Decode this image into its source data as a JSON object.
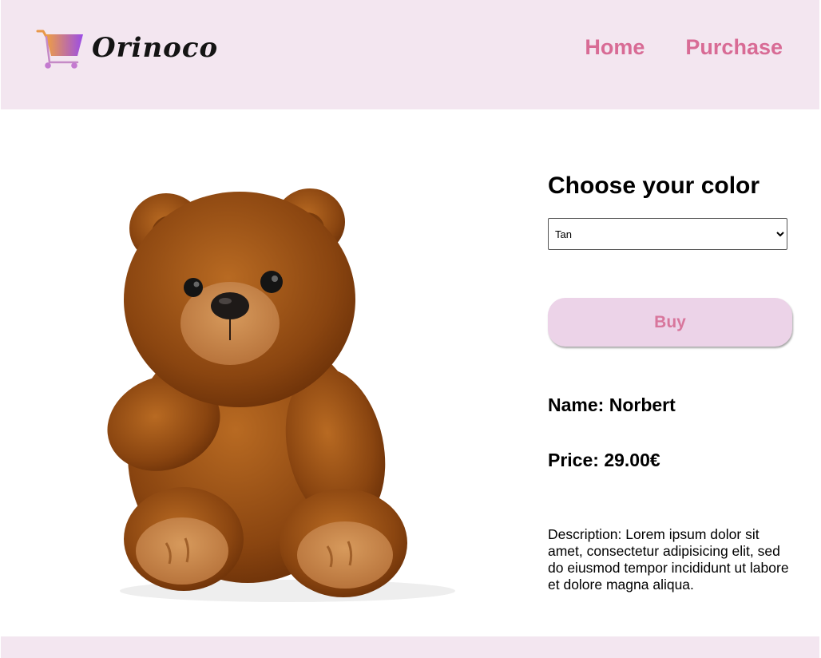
{
  "header": {
    "brand": "Orinoco",
    "nav": {
      "home": "Home",
      "purchase": "Purchase"
    }
  },
  "product": {
    "image_icon": "teddy-bear",
    "color_heading": "Choose your color",
    "color_select": {
      "selected": "Tan",
      "options": [
        "Tan"
      ]
    },
    "buy_label": "Buy",
    "name_label": "Name:",
    "name": "Norbert",
    "price_label": "Price:",
    "price": "29.00€",
    "description_label": "Description:",
    "description": "Lorem ipsum dolor sit amet, consectetur adipisicing elit, sed do eiusmod tempor incididunt ut labore et dolore magna aliqua."
  },
  "colors": {
    "header_bg": "#f3e6f0",
    "nav_link": "#d86b95",
    "button_bg": "#ecd3e8",
    "button_text": "#d8769c",
    "cart_gradient": [
      "#f0a040",
      "#9b4de8"
    ]
  }
}
